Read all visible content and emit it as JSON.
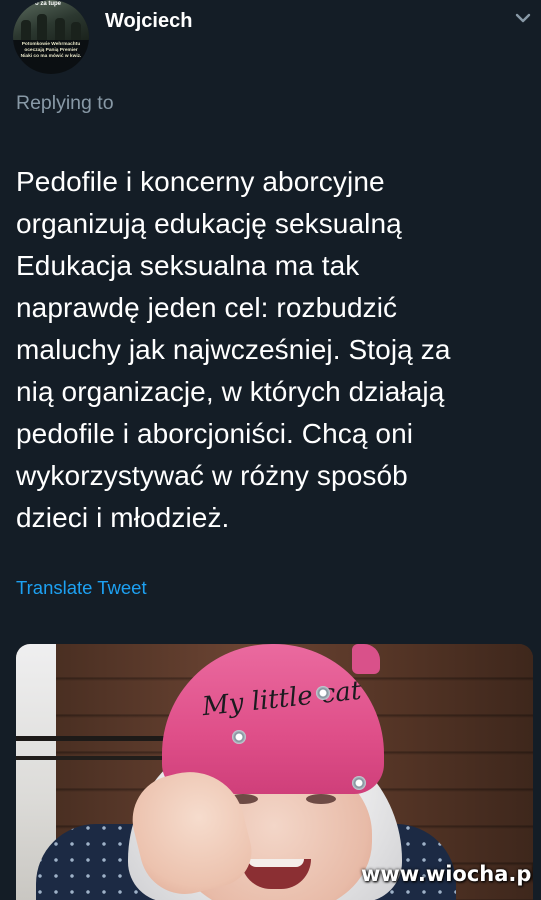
{
  "author": {
    "display_name": "Wojciech",
    "avatar_top_text": "o za tupe",
    "avatar_caption": "Potomkowie Wehrmachtu oceczają Panią Premier Niaki co ma mówić w kwiz."
  },
  "reply": {
    "label": "Replying to"
  },
  "tweet": {
    "text": "Pedofile i koncerny aborcyjne\norganizują edukację seksualną\nEdukacja seksualna ma tak\nnaprawdę jeden cel: rozbudzić\nmaluchy jak najwcześniej. Stoją za\nnią organizacje, w których działają\npedofile i aborcjoniści. Chcą oni\nwykorzystywać w różny sposób\ndzieci i młodzież.",
    "translate_label": "Translate Tweet"
  },
  "media": {
    "hat_text": "My little cat",
    "watermark": "www.wiocha.pl"
  },
  "icons": {
    "menu": "chevron-down-icon"
  },
  "colors": {
    "background": "#141d26",
    "secondary_text": "#8899a6",
    "link": "#1da1f2"
  }
}
